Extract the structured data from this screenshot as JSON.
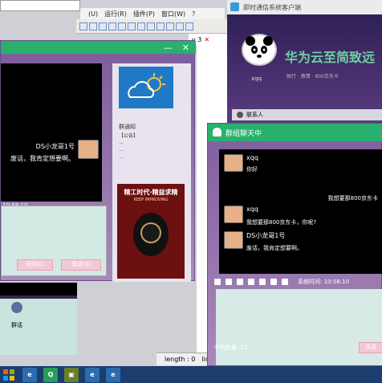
{
  "ide": {
    "menus": [
      "(U)",
      "运行(R)",
      "插件(P)",
      "窗口(W)",
      "？"
    ],
    "tab_label": "v 3",
    "tab_close": "✕",
    "status_length": "length : 0",
    "status_line": "lin"
  },
  "taskbar": {
    "items": [
      "windows-start-icon",
      "ie-browser-icon",
      "qq-icon",
      "ide-icon",
      "ie-browser-icon",
      "ie-browser-icon"
    ]
  },
  "chat1": {
    "minimize": "—",
    "close": "✕",
    "message_name": "DS小龙哥1号",
    "message_text": "废话，我肯定想要啊。",
    "toolbar_time": "10:58:10",
    "close_button": "关闭(C)",
    "send_button": "发送(S)",
    "side": {
      "notice_title": "群通知",
      "notice_lines": [
        "【公告】",
        "—",
        "—",
        "—"
      ],
      "ad_title": "精工时代·精益求精",
      "ad_sub": "KEEP IMPROVING"
    }
  },
  "mini": {
    "label": "群话"
  },
  "qq": {
    "title": "即时通信系统客户端",
    "user_name": "xqq",
    "brand": "华为云至简致远",
    "tagline": "独行 · 激情 · 800京东卡",
    "contacts": "联系人"
  },
  "group": {
    "title": "群组聊天中",
    "messages": [
      {
        "name": "xqq",
        "text": "你好"
      },
      {
        "text": "我想要那800京东卡"
      },
      {
        "name": "xqq",
        "text": "我想要那800京东卡，你呢?"
      },
      {
        "name": "DS小龙哥1号",
        "text": "废话，我肯定想要啊。"
      }
    ],
    "time": "系统时间: 10:58:10",
    "count": "字符数量: 11",
    "send": "发送"
  }
}
